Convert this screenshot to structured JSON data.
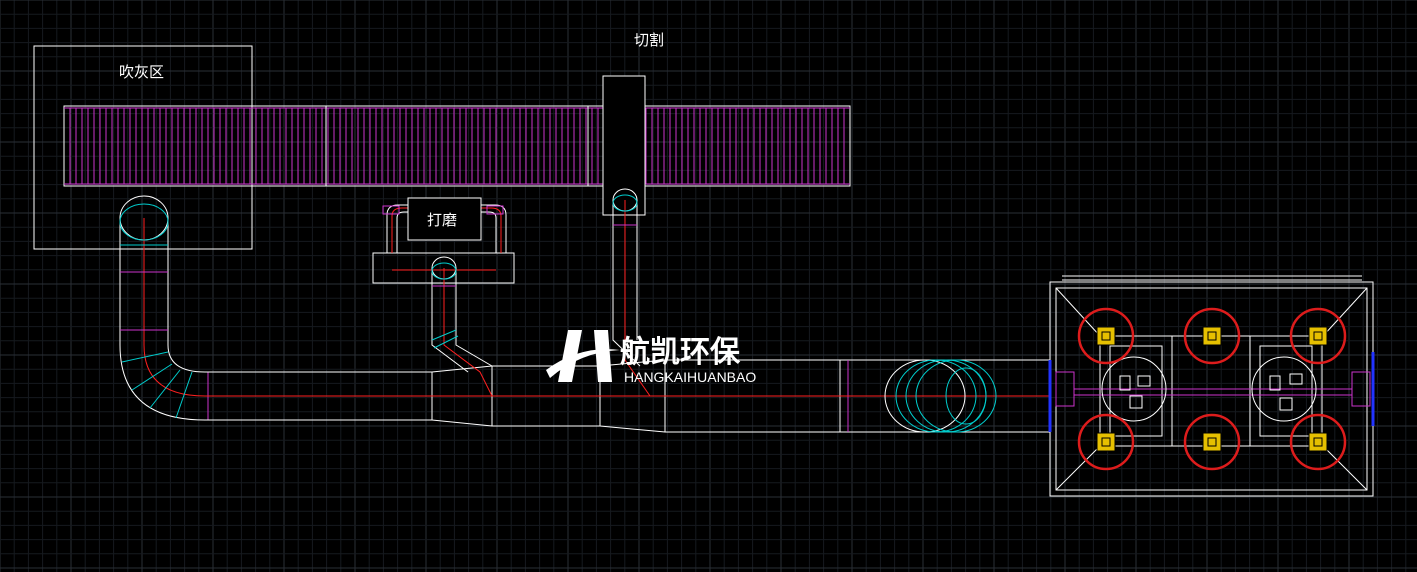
{
  "labels": {
    "blow_zone": "吹灰区",
    "grinding": "打磨",
    "cutting": "切割"
  },
  "logo": {
    "cn": "航凯环保",
    "en": "HANGKAIHUANBAO"
  },
  "colors": {
    "background": "#000000",
    "grid_major": "#2a2f36",
    "grid_minor": "#161a1f",
    "outline": "#ffffff",
    "pipe_center": "#ff2020",
    "grille": "#cc33cc",
    "elbow_section": "#00cccc",
    "filter_ring": "#dd1c1c",
    "motor": "#e6c000",
    "flange": "#2233ff"
  }
}
